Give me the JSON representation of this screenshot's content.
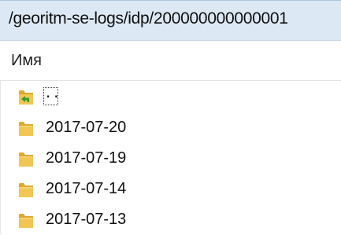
{
  "path_bar": {
    "path": "/georitm-se-logs/idp/200000000000001"
  },
  "columns": {
    "name": "Имя"
  },
  "parent_entry": {
    "label": ".."
  },
  "items": [
    {
      "name": "2017-07-20",
      "icon": "folder-icon"
    },
    {
      "name": "2017-07-19",
      "icon": "folder-icon"
    },
    {
      "name": "2017-07-14",
      "icon": "folder-icon"
    },
    {
      "name": "2017-07-13",
      "icon": "folder-icon"
    }
  ],
  "colors": {
    "path_bar_bg": "#dce8f3",
    "folder_yellow": "#f0c54f",
    "up_arrow_green": "#3a9a2e"
  }
}
